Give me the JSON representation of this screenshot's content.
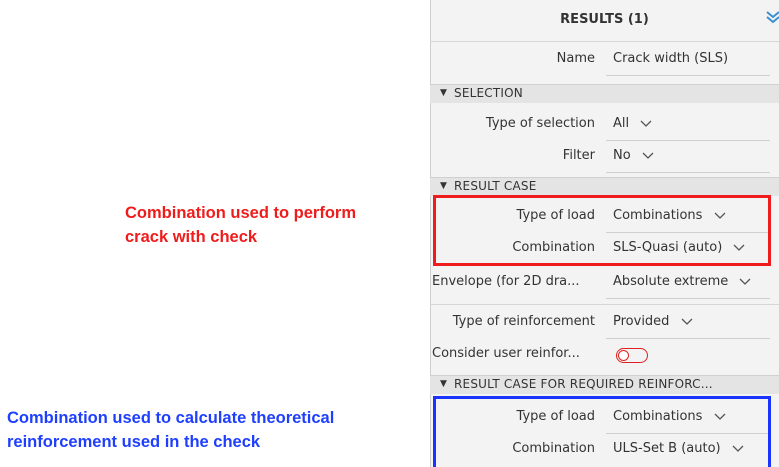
{
  "panel": {
    "title": "RESULTS (1)",
    "name_label": "Name",
    "name_value": "Crack width (SLS)"
  },
  "selection": {
    "title": "SELECTION",
    "type_label": "Type of selection",
    "type_value": "All",
    "filter_label": "Filter",
    "filter_value": "No"
  },
  "result_case": {
    "title": "RESULT CASE",
    "load_label": "Type of load",
    "load_value": "Combinations",
    "combo_label": "Combination",
    "combo_value": "SLS-Quasi (auto)"
  },
  "envelope": {
    "label": "Envelope (for 2D dra...",
    "value": "Absolute extreme"
  },
  "reinforcement": {
    "type_label": "Type of reinforcement",
    "type_value": "Provided",
    "user_label": "Consider user reinfor..."
  },
  "required": {
    "title": "RESULT CASE FOR REQUIRED REINFORC...",
    "load_label": "Type of load",
    "load_value": "Combinations",
    "combo_label": "Combination",
    "combo_value": "ULS-Set B (auto)"
  },
  "annotations": {
    "red_line1": "Combination used to perform",
    "red_line2": "crack with check",
    "blue_line1": "Combination used to calculate theoretical",
    "blue_line2": "reinforcement used in the check"
  },
  "colors": {
    "red": "#ee1c1c",
    "blue": "#1a33ff"
  },
  "icons": {
    "header": "collapse-chevrons-icon",
    "dropdown": "chevron-down-icon",
    "section": "triangle-down-icon"
  },
  "toggle_state": "off"
}
